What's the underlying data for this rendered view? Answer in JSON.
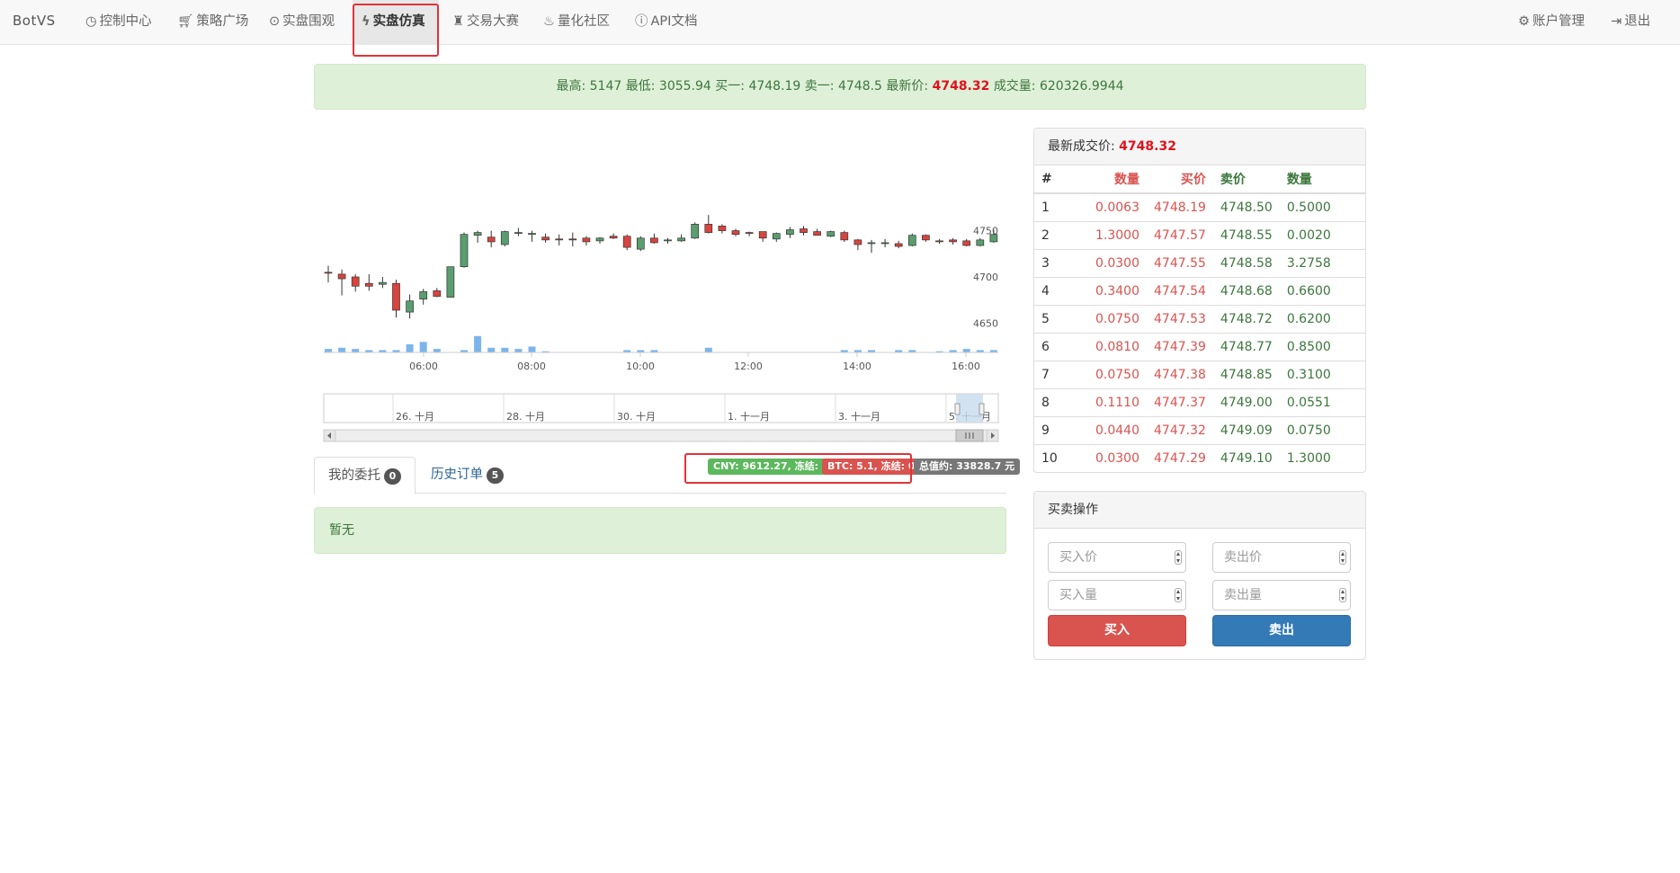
{
  "nav": {
    "brand": "BotVS",
    "items": [
      {
        "label": "控制中心",
        "icon": "dashboard-icon"
      },
      {
        "label": "策略广场",
        "icon": "cart-icon"
      },
      {
        "label": "实盘围观",
        "icon": "play-circle-icon"
      },
      {
        "label": "实盘仿真",
        "icon": "flash-icon"
      },
      {
        "label": "交易大赛",
        "icon": "trophy-icon"
      },
      {
        "label": "量化社区",
        "icon": "fire-icon"
      },
      {
        "label": "API文档",
        "icon": "info-icon"
      }
    ],
    "account": "账户管理",
    "logout": "退出"
  },
  "ticker": {
    "high_label": "最高:",
    "high": "5147",
    "low_label": "最低:",
    "low": "3055.94",
    "bid_label": "买一:",
    "bid": "4748.19",
    "ask_label": "卖一:",
    "ask": "4748.5",
    "last_label": "最新价:",
    "last": "4748.32",
    "volume_label": "成交量:",
    "volume": "620326.9944"
  },
  "chart_data": {
    "type": "candlestick",
    "time_ticks": [
      "06:00",
      "08:00",
      "10:00",
      "12:00",
      "14:00",
      "16:00"
    ],
    "price_ticks": [
      4750,
      4700,
      4650
    ],
    "price_range": [
      4630,
      4805
    ],
    "navigator_ticks": [
      "26. 十月",
      "28. 十月",
      "30. 十月",
      "1. 十一月",
      "3. 十一月",
      "5. 十一月"
    ],
    "candles": [
      {
        "o": 4705,
        "h": 4712,
        "l": 4694,
        "c": 4704
      },
      {
        "o": 4703,
        "h": 4708,
        "l": 4680,
        "c": 4698
      },
      {
        "o": 4700,
        "h": 4703,
        "l": 4684,
        "c": 4690
      },
      {
        "o": 4693,
        "h": 4703,
        "l": 4685,
        "c": 4690
      },
      {
        "o": 4692,
        "h": 4700,
        "l": 4688,
        "c": 4694
      },
      {
        "o": 4693,
        "h": 4697,
        "l": 4656,
        "c": 4664
      },
      {
        "o": 4662,
        "h": 4681,
        "l": 4655,
        "c": 4674
      },
      {
        "o": 4676,
        "h": 4687,
        "l": 4670,
        "c": 4684
      },
      {
        "o": 4685,
        "h": 4688,
        "l": 4678,
        "c": 4679
      },
      {
        "o": 4678,
        "h": 4711,
        "l": 4678,
        "c": 4711
      },
      {
        "o": 4711,
        "h": 4748,
        "l": 4710,
        "c": 4746
      },
      {
        "o": 4745,
        "h": 4750,
        "l": 4737,
        "c": 4748
      },
      {
        "o": 4743,
        "h": 4750,
        "l": 4732,
        "c": 4738
      },
      {
        "o": 4735,
        "h": 4750,
        "l": 4733,
        "c": 4749
      },
      {
        "o": 4748,
        "h": 4753,
        "l": 4744,
        "c": 4748
      },
      {
        "o": 4746,
        "h": 4750,
        "l": 4738,
        "c": 4747
      },
      {
        "o": 4743,
        "h": 4747,
        "l": 4737,
        "c": 4740
      },
      {
        "o": 4741,
        "h": 4746,
        "l": 4734,
        "c": 4740
      },
      {
        "o": 4741,
        "h": 4748,
        "l": 4733,
        "c": 4740
      },
      {
        "o": 4742,
        "h": 4744,
        "l": 4734,
        "c": 4738
      },
      {
        "o": 4739,
        "h": 4743,
        "l": 4736,
        "c": 4742
      },
      {
        "o": 4744,
        "h": 4747,
        "l": 4741,
        "c": 4742
      },
      {
        "o": 4744,
        "h": 4746,
        "l": 4729,
        "c": 4732
      },
      {
        "o": 4730,
        "h": 4744,
        "l": 4728,
        "c": 4742
      },
      {
        "o": 4742,
        "h": 4747,
        "l": 4736,
        "c": 4737
      },
      {
        "o": 4739,
        "h": 4742,
        "l": 4736,
        "c": 4740
      },
      {
        "o": 4739,
        "h": 4746,
        "l": 4738,
        "c": 4742
      },
      {
        "o": 4742,
        "h": 4759,
        "l": 4741,
        "c": 4757
      },
      {
        "o": 4757,
        "h": 4767,
        "l": 4747,
        "c": 4748
      },
      {
        "o": 4755,
        "h": 4757,
        "l": 4747,
        "c": 4750
      },
      {
        "o": 4750,
        "h": 4752,
        "l": 4744,
        "c": 4746
      },
      {
        "o": 4748,
        "h": 4749,
        "l": 4744,
        "c": 4747
      },
      {
        "o": 4749,
        "h": 4749,
        "l": 4738,
        "c": 4742
      },
      {
        "o": 4741,
        "h": 4748,
        "l": 4738,
        "c": 4747
      },
      {
        "o": 4746,
        "h": 4754,
        "l": 4742,
        "c": 4751
      },
      {
        "o": 4752,
        "h": 4755,
        "l": 4745,
        "c": 4748
      },
      {
        "o": 4749,
        "h": 4752,
        "l": 4745,
        "c": 4745
      },
      {
        "o": 4744,
        "h": 4750,
        "l": 4743,
        "c": 4749
      },
      {
        "o": 4748,
        "h": 4750,
        "l": 4738,
        "c": 4740
      },
      {
        "o": 4740,
        "h": 4741,
        "l": 4729,
        "c": 4735
      },
      {
        "o": 4737,
        "h": 4740,
        "l": 4726,
        "c": 4737
      },
      {
        "o": 4737,
        "h": 4741,
        "l": 4732,
        "c": 4737
      },
      {
        "o": 4736,
        "h": 4739,
        "l": 4731,
        "c": 4733
      },
      {
        "o": 4734,
        "h": 4747,
        "l": 4733,
        "c": 4745
      },
      {
        "o": 4745,
        "h": 4746,
        "l": 4738,
        "c": 4740
      },
      {
        "o": 4739,
        "h": 4741,
        "l": 4736,
        "c": 4738
      },
      {
        "o": 4740,
        "h": 4742,
        "l": 4735,
        "c": 4738
      },
      {
        "o": 4739,
        "h": 4741,
        "l": 4733,
        "c": 4734
      },
      {
        "o": 4734,
        "h": 4742,
        "l": 4733,
        "c": 4740
      },
      {
        "o": 4738,
        "h": 4751,
        "l": 4737,
        "c": 4746
      },
      {
        "o": 4746,
        "h": 4754,
        "l": 4744,
        "c": 4749
      }
    ],
    "volumes": [
      3,
      4,
      3,
      2,
      2,
      2,
      7,
      9,
      3,
      0,
      2,
      14,
      4,
      4,
      3,
      5,
      1,
      0,
      0,
      0,
      0,
      0,
      2,
      2,
      2,
      0,
      0,
      0,
      4,
      0,
      0,
      0,
      0,
      0,
      0,
      0,
      0,
      0,
      2,
      2,
      2,
      0,
      2,
      2,
      0,
      1,
      2,
      3,
      2,
      2,
      2
    ],
    "up_color": "#5a9e6f",
    "down_color": "#d9443f",
    "volume_color": "#7cb5ec"
  },
  "tabs": {
    "orders": {
      "label": "我的委托",
      "count": "0"
    },
    "history": {
      "label": "历史订单",
      "count": "5"
    }
  },
  "balance": {
    "cny": "CNY: 9612.27, 冻结: 0",
    "btc": "BTC: 5.1, 冻结: 0",
    "total": "总值约: 33828.7 元"
  },
  "orders_empty": "暂无",
  "orderbook": {
    "title": "最新成交价:",
    "last": "4748.32",
    "headers": [
      "#",
      "数量",
      "买价",
      "卖价",
      "数量"
    ],
    "rows": [
      [
        "1",
        "0.0063",
        "4748.19",
        "4748.50",
        "0.5000"
      ],
      [
        "2",
        "1.3000",
        "4747.57",
        "4748.55",
        "0.0020"
      ],
      [
        "3",
        "0.0300",
        "4747.55",
        "4748.58",
        "3.2758"
      ],
      [
        "4",
        "0.3400",
        "4747.54",
        "4748.68",
        "0.6600"
      ],
      [
        "5",
        "0.0750",
        "4747.53",
        "4748.72",
        "0.6200"
      ],
      [
        "6",
        "0.0810",
        "4747.39",
        "4748.77",
        "0.8500"
      ],
      [
        "7",
        "0.0750",
        "4747.38",
        "4748.85",
        "0.3100"
      ],
      [
        "8",
        "0.1110",
        "4747.37",
        "4749.00",
        "0.0551"
      ],
      [
        "9",
        "0.0440",
        "4747.32",
        "4749.09",
        "0.0750"
      ],
      [
        "10",
        "0.0300",
        "4747.29",
        "4749.10",
        "1.3000"
      ]
    ]
  },
  "trade": {
    "title": "买卖操作",
    "buy_price_ph": "买入价",
    "sell_price_ph": "卖出价",
    "buy_amount_ph": "买入量",
    "sell_amount_ph": "卖出量",
    "buy_label": "买入",
    "sell_label": "卖出"
  }
}
